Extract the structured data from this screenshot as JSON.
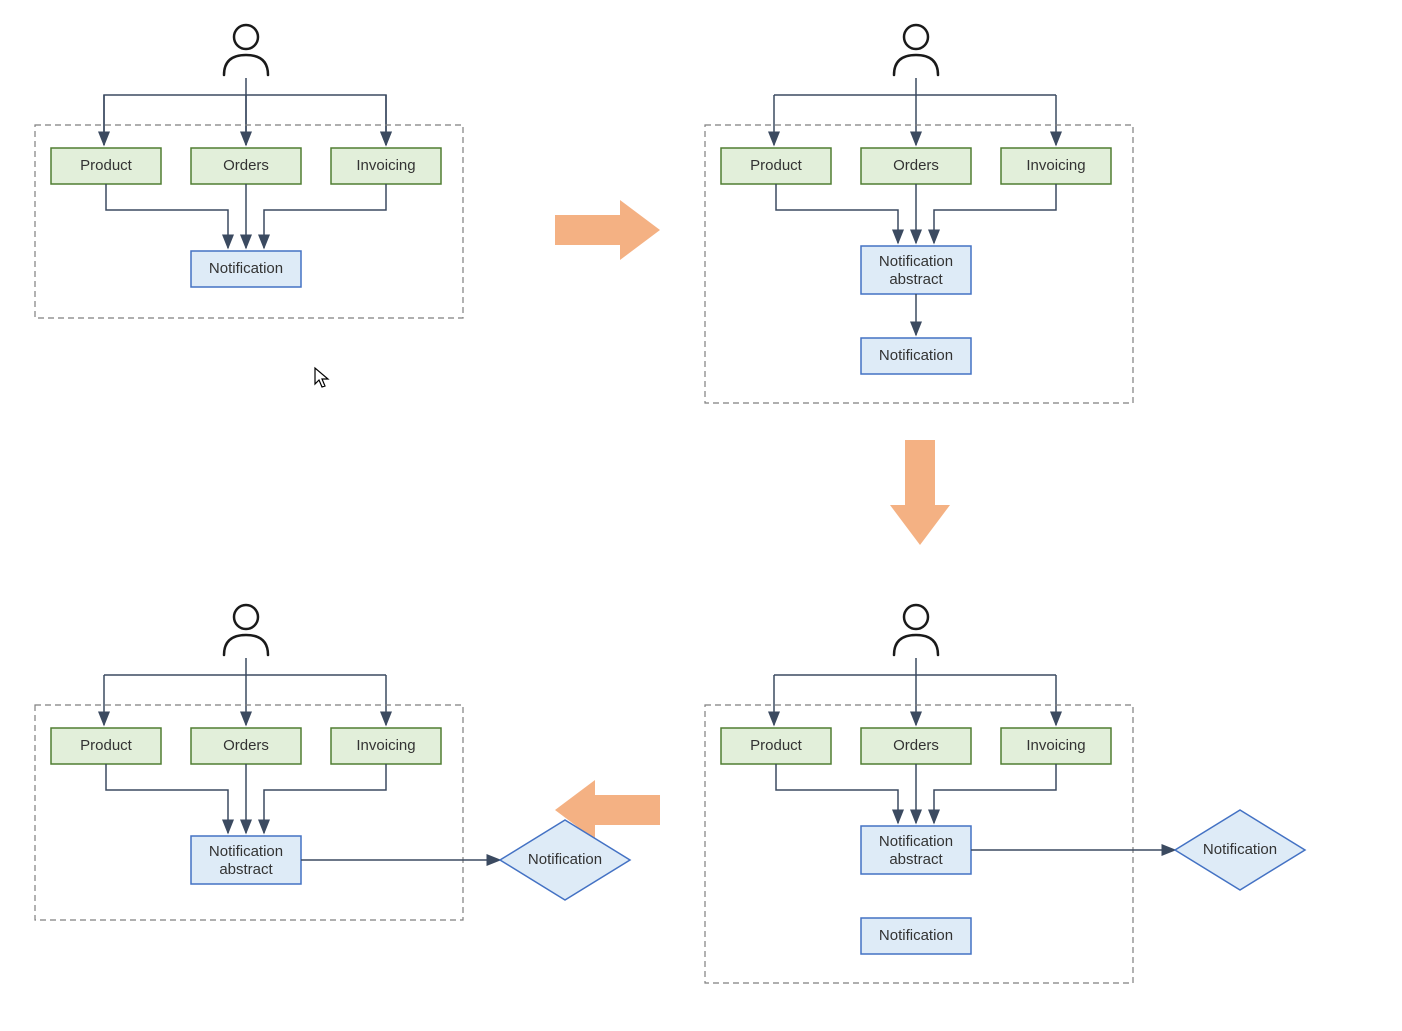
{
  "labels": {
    "product": "Product",
    "orders": "Orders",
    "invoicing": "Invoicing",
    "notification": "Notification",
    "notification_abstract_l1": "Notification",
    "notification_abstract_l2": "abstract"
  },
  "diagrams": {
    "top_left": {
      "modules": [
        "Product",
        "Orders",
        "Invoicing"
      ],
      "target": "Notification"
    },
    "top_right": {
      "modules": [
        "Product",
        "Orders",
        "Invoicing"
      ],
      "abstract": "Notification abstract",
      "target": "Notification"
    },
    "bottom_right": {
      "modules": [
        "Product",
        "Orders",
        "Invoicing"
      ],
      "abstract": "Notification abstract",
      "extra_box": "Notification",
      "external_diamond": "Notification"
    },
    "bottom_left": {
      "modules": [
        "Product",
        "Orders",
        "Invoicing"
      ],
      "abstract": "Notification abstract",
      "external_diamond": "Notification"
    }
  },
  "flow_sequence": [
    "top_left",
    "top_right",
    "bottom_right",
    "bottom_left"
  ],
  "colors": {
    "green_fill": "#e2efda",
    "green_stroke": "#507e32",
    "blue_fill": "#deebf7",
    "blue_stroke": "#4472c4",
    "arrow_fill": "#f4b183",
    "connector": "#3b4a60",
    "dashed": "#7f7f7f"
  }
}
